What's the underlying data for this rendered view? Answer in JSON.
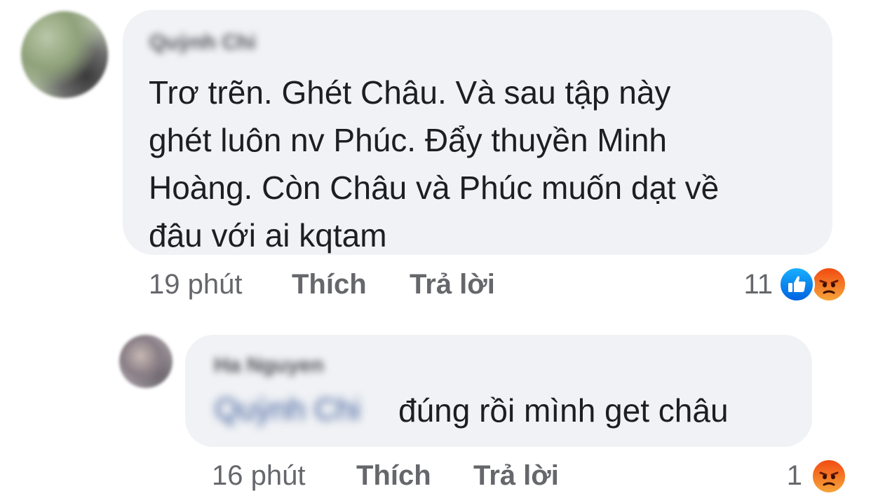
{
  "comments": [
    {
      "author": "Quỳnh Chi",
      "text": "Trơ trẽn. Ghét Châu. Và sau tập này\nghét luôn nv Phúc. Đẩy thuyền Minh\nHoàng. Còn Châu và Phúc muốn dạt về\nđâu với ai kqtam",
      "time": "19 phút",
      "like_label": "Thích",
      "reply_label": "Trả lời",
      "reaction_count": "11",
      "reactions": [
        "like-icon",
        "angry-icon"
      ]
    },
    {
      "author": "Ha Nguyen",
      "mention": "Quỳnh Chi",
      "text": "đúng rồi mình get châu",
      "time": "16 phút",
      "like_label": "Thích",
      "reply_label": "Trả lời",
      "reaction_count": "1",
      "reactions": [
        "angry-icon"
      ]
    }
  ],
  "colors": {
    "bubble": "#f0f2f5",
    "meta_text": "#65676b",
    "body_text": "#1c1e21",
    "mention": "#385898",
    "like_blue": "#0866ff",
    "angry_orange": "#f3702a"
  }
}
